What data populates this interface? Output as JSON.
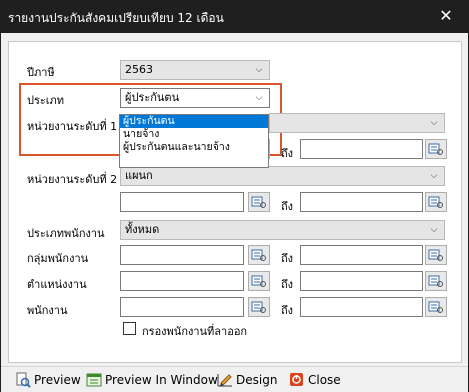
{
  "window": {
    "title": "รายงานประกันสังคมเปรียบเทียบ 12 เดือน",
    "close_glyph": "✕"
  },
  "form": {
    "tax_year": {
      "label": "ปีภาษี",
      "value": "2563"
    },
    "type": {
      "label": "ประเภท",
      "value": "ผู้ประกันตน",
      "options": [
        "ผู้ประกันตน",
        "นายจ้าง",
        "ผู้ประกันตนและนายจ้าง"
      ],
      "selected_index": 0
    },
    "unit_level1": {
      "label": "หน่วยงานระดับที่ 1",
      "to_label": "ถึง"
    },
    "unit_level2": {
      "label": "หน่วยงานระดับที่ 2",
      "value": "แผนก",
      "to_label": "ถึง"
    },
    "employee_type": {
      "label": "ประเภทพนักงาน",
      "value": "ทั้งหมด"
    },
    "employee_group": {
      "label": "กลุ่มพนักงาน",
      "to_label": "ถึง"
    },
    "position": {
      "label": "ตำแหน่งงาน",
      "to_label": "ถึง"
    },
    "employee": {
      "label": "พนักงาน",
      "to_label": "ถึง"
    },
    "filter_resigned": {
      "label": "กรองพนักงานที่ลาออก",
      "checked": false
    }
  },
  "toolbar": {
    "preview": "Preview",
    "preview_window": "Preview In Window",
    "design": "Design",
    "close": "Close"
  },
  "icons": {
    "lookup": "lookup-icon",
    "dropdown": "chevron-down-icon",
    "preview": "magnifier-document-icon",
    "preview_window": "window-icon",
    "design": "design-pencil-icon",
    "close": "close-icon"
  },
  "colors": {
    "highlight": "#d9552b",
    "selection": "#0078d7",
    "titlebar": "#1f1f1f"
  }
}
